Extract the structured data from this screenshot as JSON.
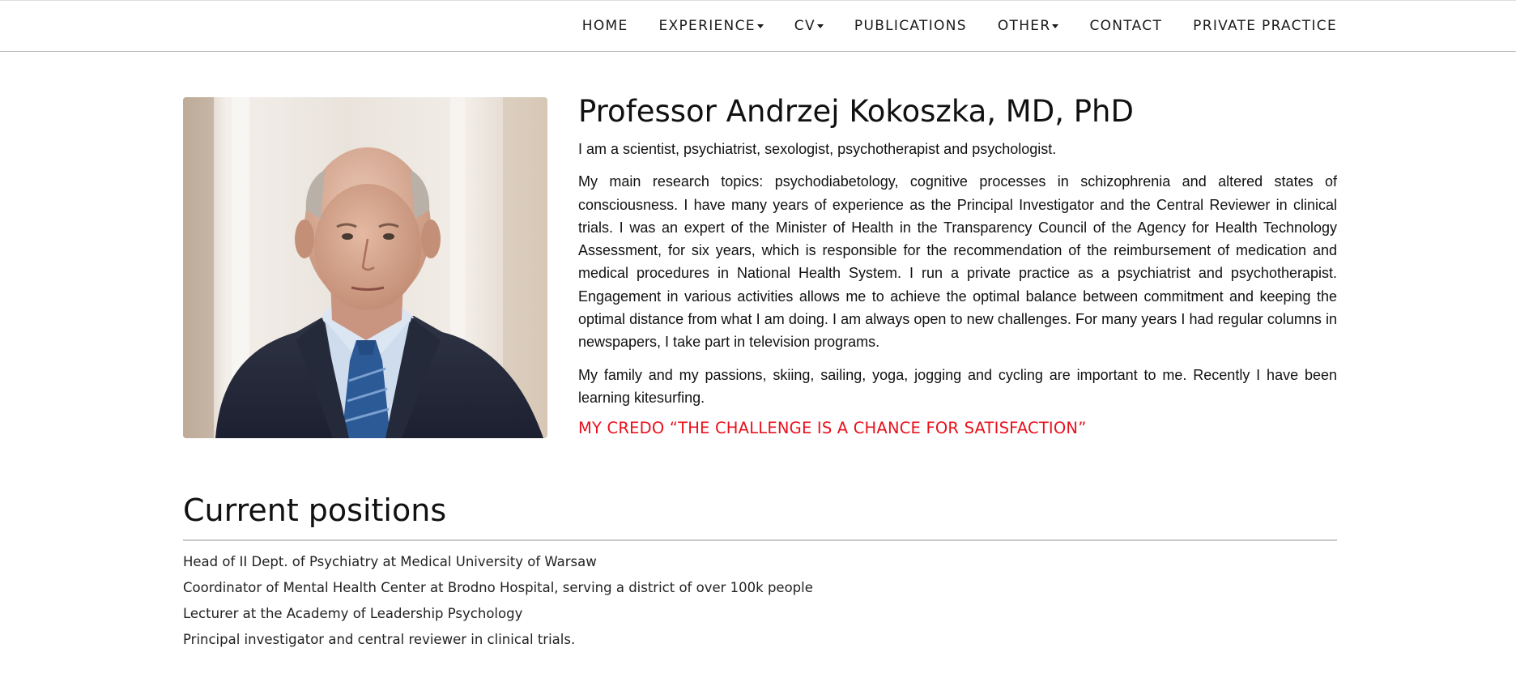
{
  "nav": {
    "items": [
      {
        "label": "HOME",
        "dropdown": false
      },
      {
        "label": "EXPERIENCE",
        "dropdown": true
      },
      {
        "label": "CV",
        "dropdown": true
      },
      {
        "label": "PUBLICATIONS",
        "dropdown": false
      },
      {
        "label": "OTHER",
        "dropdown": true
      },
      {
        "label": "CONTACT",
        "dropdown": false
      },
      {
        "label": "PRIVATE PRACTICE",
        "dropdown": false
      }
    ]
  },
  "profile": {
    "name": "Professor Andrzej Kokoszka, MD, PhD",
    "paragraphs": [
      "I am a scientist, psychiatrist, sexologist, psychotherapist and psychologist.",
      "My main research topics: psychodiabetology, cognitive processes in schizophrenia and altered states of consciousness. I have many years of experience as the Principal Investigator and the Central Reviewer in clinical trials. I was an expert of the Minister of Health in the Transparency Council of the Agency for Health Technology Assessment, for six years, which is responsible for the recommendation of the reimbursement of medication and medical procedures in National Health System. I run a private practice as a psychiatrist and psychotherapist. Engagement in various activities allows me to achieve the optimal balance between commitment and keeping the optimal distance from what I am doing. I am always open to new challenges. For many years I had regular columns in newspapers, I take part in television programs.",
      "My family and my passions, skiing, sailing, yoga, jogging and cycling are important to me. Recently I have been learning kitesurfing."
    ],
    "credo": "MY CREDO “THE CHALLENGE IS A CHANCE FOR SATISFACTION”"
  },
  "positions": {
    "heading": "Current positions",
    "items": [
      "Head of II Dept. of Psychiatry at Medical University of Warsaw",
      "Coordinator of Mental Health Center at Brodno Hospital, serving a district of over 100k people",
      "Lecturer at the Academy of Leadership Psychology",
      "Principal investigator and central reviewer in clinical trials."
    ]
  },
  "colors": {
    "credo": "#e8111d",
    "text": "#111111",
    "rule": "#c8c8c8"
  }
}
